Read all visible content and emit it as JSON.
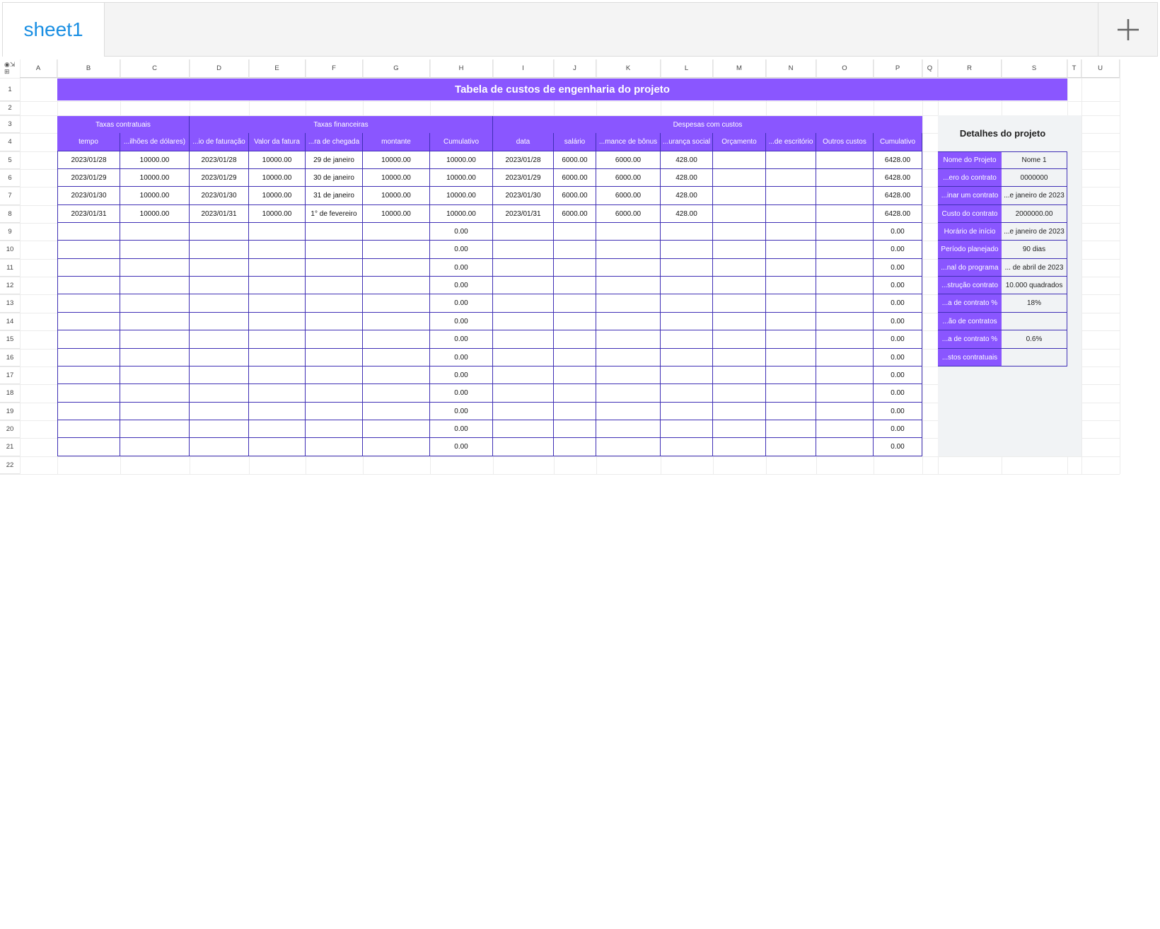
{
  "tabs": [
    {
      "label": "sheet1"
    }
  ],
  "columns": [
    "A",
    "B",
    "C",
    "D",
    "E",
    "F",
    "G",
    "H",
    "I",
    "J",
    "K",
    "L",
    "M",
    "N",
    "O",
    "P",
    "Q",
    "R",
    "S",
    "T",
    "U"
  ],
  "rows": [
    "1",
    "2",
    "3",
    "4",
    "5",
    "6",
    "7",
    "8",
    "9",
    "10",
    "11",
    "12",
    "13",
    "14",
    "15",
    "16",
    "17",
    "18",
    "19",
    "20",
    "21",
    "22"
  ],
  "title": "Tabela de custos de engenharia do projeto",
  "groups": {
    "contratuais": "Taxas contratuais",
    "financeiras": "Taxas financeiras",
    "despesas": "Despesas com custos"
  },
  "headers": [
    "tempo",
    "...ilhões de dólares)",
    "...io de faturação",
    "Valor da fatura",
    "...ra de chegada",
    "montante",
    "Cumulativo",
    "data",
    "salário",
    "...mance de bônus",
    "...urança social",
    "Orçamento",
    "...de escritório",
    "Outros custos",
    "Cumulativo"
  ],
  "data_rows": [
    [
      "2023/01/28",
      "10000.00",
      "2023/01/28",
      "10000.00",
      "29 de janeiro",
      "10000.00",
      "10000.00",
      "2023/01/28",
      "6000.00",
      "6000.00",
      "428.00",
      "",
      "",
      "",
      "6428.00"
    ],
    [
      "2023/01/29",
      "10000.00",
      "2023/01/29",
      "10000.00",
      "30 de janeiro",
      "10000.00",
      "10000.00",
      "2023/01/29",
      "6000.00",
      "6000.00",
      "428.00",
      "",
      "",
      "",
      "6428.00"
    ],
    [
      "2023/01/30",
      "10000.00",
      "2023/01/30",
      "10000.00",
      "31 de janeiro",
      "10000.00",
      "10000.00",
      "2023/01/30",
      "6000.00",
      "6000.00",
      "428.00",
      "",
      "",
      "",
      "6428.00"
    ],
    [
      "2023/01/31",
      "10000.00",
      "2023/01/31",
      "10000.00",
      "1° de fevereiro",
      "10000.00",
      "10000.00",
      "2023/01/31",
      "6000.00",
      "6000.00",
      "428.00",
      "",
      "",
      "",
      "6428.00"
    ]
  ],
  "empty_cumulative": "0.00",
  "details": {
    "title": "Detalhes do projeto",
    "items": [
      {
        "label": "Nome do Projeto",
        "value": "Nome 1"
      },
      {
        "label": "...ero do contrato",
        "value": "0000000"
      },
      {
        "label": "...inar um contrato",
        "value": "...e janeiro de 2023"
      },
      {
        "label": "Custo do contrato",
        "value": "2000000.00"
      },
      {
        "label": "Horário de início",
        "value": "...e janeiro de 2023"
      },
      {
        "label": "Período planejado",
        "value": "90 dias"
      },
      {
        "label": "...nal do programa",
        "value": "... de abril de 2023"
      },
      {
        "label": "...strução contrato",
        "value": "10.000 quadrados"
      },
      {
        "label": "...a de contrato %",
        "value": "18%"
      },
      {
        "label": "...ão de contratos",
        "value": ""
      },
      {
        "label": "...a de contrato %",
        "value": "0.6%"
      },
      {
        "label": "...stos contratuais",
        "value": ""
      }
    ]
  },
  "colors": {
    "accent": "#8a56ff",
    "border": "#3f2fb5",
    "panel": "#f1f3f5",
    "tab_text": "#1a8fe3"
  },
  "icons": {
    "add": "plus-icon",
    "corner": "eye-icon"
  }
}
